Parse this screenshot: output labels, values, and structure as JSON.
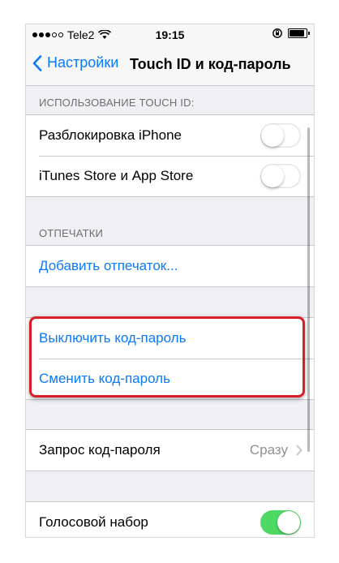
{
  "status_bar": {
    "carrier": "Tele2",
    "time": "19:15",
    "signal_icon": "signal-dots-icon",
    "wifi_icon": "wifi-icon",
    "lock_icon": "orientation-lock-icon",
    "battery_icon": "battery-icon"
  },
  "nav": {
    "back_label": "Настройки",
    "back_icon": "chevron-left-icon",
    "title": "Touch ID и код-пароль"
  },
  "sections": {
    "touch_id_header": "ИСПОЛЬЗОВАНИЕ TOUCH ID:",
    "touch_id_rows": [
      {
        "label": "Разблокировка iPhone",
        "toggle_on": false
      },
      {
        "label": "iTunes Store и App Store",
        "toggle_on": false
      }
    ],
    "fingerprints_header": "ОТПЕЧАТКИ",
    "add_fingerprint_label": "Добавить отпечаток...",
    "passcode_rows": [
      {
        "label": "Выключить код-пароль"
      },
      {
        "label": "Сменить код-пароль"
      }
    ],
    "require_passcode": {
      "label": "Запрос код-пароля",
      "value": "Сразу",
      "icon": "chevron-right-icon"
    },
    "voice_dial": {
      "label": "Голосовой набор",
      "toggle_on": true
    }
  },
  "colors": {
    "accent": "#0a7aff",
    "toggle_on": "#4cd964",
    "highlight": "#d71f2a",
    "grouped_background": "#efeff4"
  }
}
